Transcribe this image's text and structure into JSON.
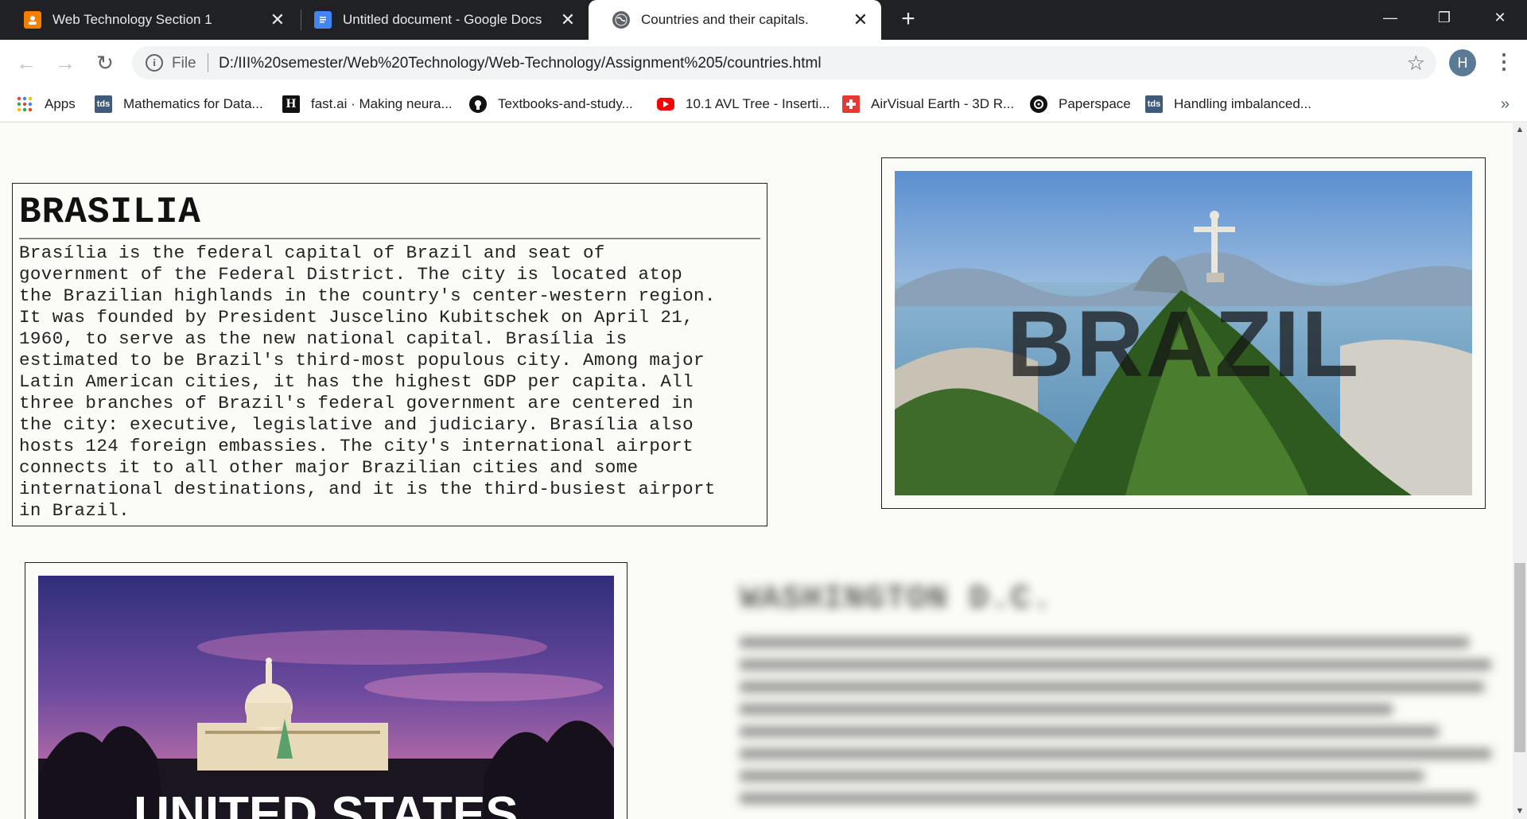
{
  "browser": {
    "tabs": [
      {
        "title": "Web Technology Section 1",
        "icon": "blogger-icon",
        "active": false
      },
      {
        "title": "Untitled document - Google Docs",
        "icon": "google-docs-icon",
        "active": false
      },
      {
        "title": "Countries and their capitals.",
        "icon": "globe-icon",
        "active": true
      }
    ],
    "new_tab": "+",
    "window_buttons": {
      "minimize": "—",
      "restore": "❐",
      "close": "✕"
    }
  },
  "toolbar": {
    "back": "←",
    "forward": "→",
    "reload": "↻",
    "url_scheme_label": "File",
    "url": "D:/III%20semester/Web%20Technology/Web-Technology/Assignment%205/countries.html",
    "profile_initial": "H",
    "menu": "⋮",
    "star": "☆"
  },
  "bookmarks": [
    {
      "label": "Apps",
      "icon": "apps-grid-icon"
    },
    {
      "label": "Mathematics for Data...",
      "icon": "tds-icon"
    },
    {
      "label": "fast.ai · Making neura...",
      "icon": "h-icon"
    },
    {
      "label": "Textbooks-and-study...",
      "icon": "github-icon"
    },
    {
      "label": "10.1 AVL Tree - Inserti...",
      "icon": "youtube-icon"
    },
    {
      "label": "AirVisual Earth - 3D R...",
      "icon": "airvisual-icon"
    },
    {
      "label": "Paperspace",
      "icon": "paperspace-icon"
    },
    {
      "label": "Handling imbalanced...",
      "icon": "tds-icon"
    }
  ],
  "bookmarks_more": "»",
  "page": {
    "brazil": {
      "capital_title": "BRASILIA",
      "capital_lines": [
        "Brasília is the federal capital of Brazil and seat of",
        "government of the Federal District. The city is located atop",
        "the Brazilian highlands in the country's center-western region.",
        "It was founded by President Juscelino Kubitschek on April 21,",
        "1960, to serve as the new national capital. Brasília is",
        "estimated to be Brazil's third-most populous city. Among major",
        "Latin American cities, it has the highest GDP per capita. All",
        "three branches of Brazil's federal government are centered in",
        "the city: executive, legislative and judiciary. Brasília also",
        "hosts 124 foreign embassies. The city's international airport",
        "connects it to all other major Brazilian cities and some",
        "international destinations, and it is the third-busiest airport",
        "in Brazil."
      ],
      "photo_label": "BRAZIL"
    },
    "usa": {
      "photo_label": "UNITED STATES",
      "capital_title": "WASHINGTON D.C."
    }
  }
}
